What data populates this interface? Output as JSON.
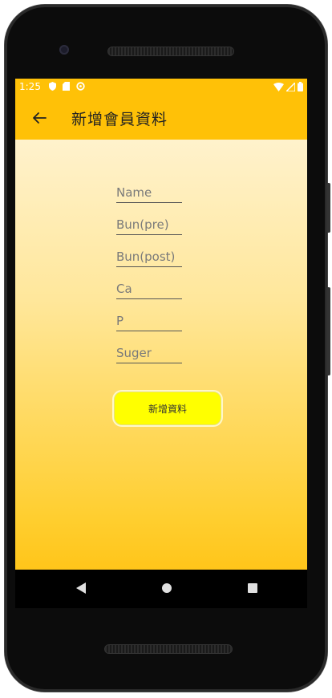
{
  "status_bar": {
    "time": "1:25",
    "icons_left": [
      "shield-icon",
      "sd-card-icon",
      "sync-icon"
    ],
    "icons_right": [
      "wifi-icon",
      "signal-icon",
      "battery-icon"
    ]
  },
  "app_bar": {
    "title": "新增會員資料",
    "back_icon": "arrow-left-icon"
  },
  "form": {
    "fields": [
      {
        "placeholder": "Name",
        "value": ""
      },
      {
        "placeholder": "Bun(pre)",
        "value": ""
      },
      {
        "placeholder": "Bun(post)",
        "value": ""
      },
      {
        "placeholder": "Ca",
        "value": ""
      },
      {
        "placeholder": "P",
        "value": ""
      },
      {
        "placeholder": "Suger",
        "value": ""
      }
    ],
    "submit_label": "新增資料"
  },
  "nav_bar": {
    "icons": [
      "back-triangle-icon",
      "home-circle-icon",
      "recents-square-icon"
    ]
  },
  "colors": {
    "app_bar": "#ffc107",
    "background_top": "#fff6df",
    "background_bottom": "#ffc51a",
    "button": "#ffff00"
  }
}
